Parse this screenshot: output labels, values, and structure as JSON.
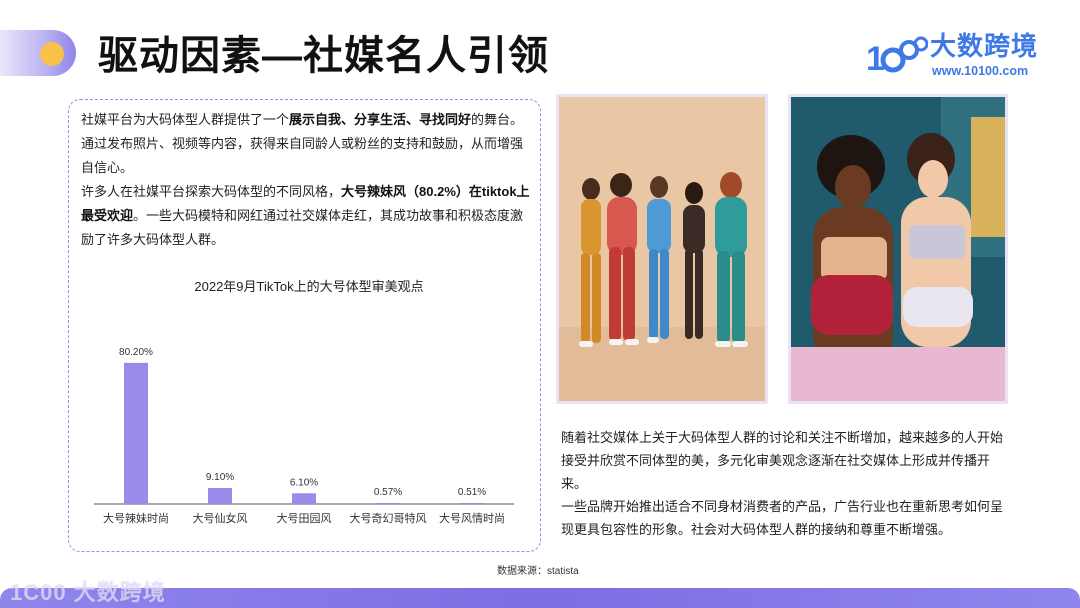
{
  "header": {
    "title": "驱动因素—社媒名人引领"
  },
  "logo": {
    "mark": "1C00",
    "name": "大数跨境",
    "url": "www.10100.com"
  },
  "intro": {
    "p1_a": "社媒平台为大码体型人群提供了一个",
    "p1_bold": "展示自我、分享生活、寻找同好",
    "p1_b": "的舞台。通过发布照片、视频等内容，获得来自同龄人或粉丝的支持和鼓励，从而增强自信心。",
    "p2_a": "许多人在社媒平台探索大码体型的不同风格，",
    "p2_bold": "大号辣妹风（80.2%）在tiktok上最受欢迎",
    "p2_b": "。一些大码模特和网红通过社交媒体走红，其成功故事和积极态度激励了许多大码体型人群。"
  },
  "chart_data": {
    "type": "bar",
    "title": "2022年9月TikTok上的大号体型审美观点",
    "categories": [
      "大号辣妹时尚",
      "大号仙女风",
      "大号田园风",
      "大号奇幻哥特风",
      "大号风情时尚"
    ],
    "values": [
      80.2,
      9.1,
      6.1,
      0.57,
      0.51
    ],
    "labels": [
      "80.20%",
      "9.10%",
      "6.10%",
      "0.57%",
      "0.51%"
    ],
    "ylim": [
      0,
      100
    ],
    "grid": false,
    "bar_color": "#9b8aea"
  },
  "right_text": {
    "p1": "随着社交媒体上关于大码体型人群的讨论和关注不断增加，越来越多的人开始接受并欣赏不同体型的美，多元化审美观念逐渐在社交媒体上形成并传播开来。",
    "p2": "一些品牌开始推出适合不同身材消费者的产品，广告行业也在重新思考如何呈现更具包容性的形象。社会对大码体型人群的接纳和尊重不断增强。"
  },
  "source": "数据来源：statista",
  "footer": {
    "watermark": "1C00 大数跨境"
  },
  "colors": {
    "accent": "#8f84e8",
    "brand_blue": "#3e79e6",
    "dashed_border": "#9b8ce8",
    "pill_dot": "#f8c24a"
  }
}
